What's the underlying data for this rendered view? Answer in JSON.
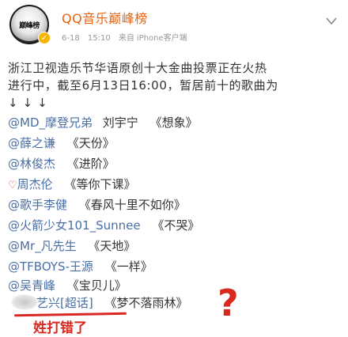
{
  "account": {
    "avatar_text": "巅峰榜",
    "name": "QQ音乐巅峰榜",
    "date": "6-18",
    "time": "15:10",
    "source_prefix": "来自",
    "source": "iPhone客户端"
  },
  "post": {
    "intro_line1": "浙江卫视造乐节华语原创十大金曲投票正在火热",
    "intro_line2": "进行中，截至6月13日16:00，暂居前十的歌曲为",
    "arrows": "↓ ↓ ↓",
    "entries": [
      {
        "prefix": "@",
        "mention": "MD_摩登兄弟",
        "artist": "刘宇宁",
        "song": "《想象》"
      },
      {
        "prefix": "@",
        "mention": "薛之谦",
        "artist": "",
        "song": "《天份》"
      },
      {
        "prefix": "@",
        "mention": "林俊杰",
        "artist": "",
        "song": "《进阶》"
      },
      {
        "prefix": "",
        "mention": "周杰伦",
        "artist": "",
        "song": "《等你下课》"
      },
      {
        "prefix": "@",
        "mention": "歌手李健",
        "artist": "",
        "song": "《春风十里不如你》"
      },
      {
        "prefix": "@",
        "mention": "火箭少女101_Sunnee",
        "artist": "",
        "song": "《不哭》"
      },
      {
        "prefix": "@",
        "mention": "Mr_凡先生",
        "artist": "",
        "song": "《天地》"
      },
      {
        "prefix": "@",
        "mention": "TFBOYS-王源",
        "artist": "",
        "song": "《一样》"
      },
      {
        "prefix": "@",
        "mention": "吴青峰",
        "artist": "",
        "song": "《宝贝儿》"
      },
      {
        "prefix": "",
        "mention": "艺兴[超话]",
        "artist": "",
        "song": "《梦不落雨林》"
      }
    ]
  },
  "annotation": {
    "text": "姓打错了",
    "mark": "?"
  },
  "colors": {
    "account_name": "#e8620c",
    "mention": "#4a6ea6",
    "annotation": "#d8281f"
  }
}
